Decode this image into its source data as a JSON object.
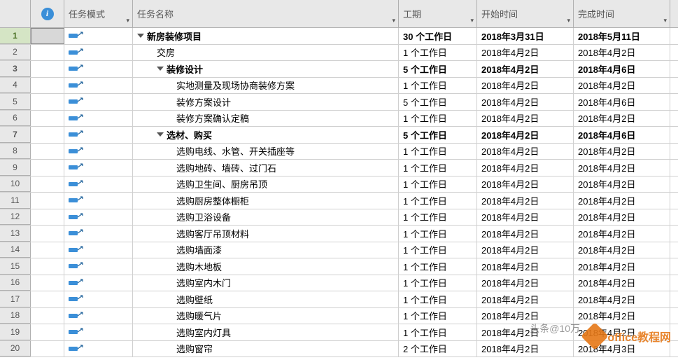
{
  "columns": {
    "task_mode": "任务模式",
    "task_name": "任务名称",
    "duration": "工期",
    "start": "开始时间",
    "finish": "完成时间"
  },
  "selected_row": 1,
  "rows": [
    {
      "num": 1,
      "indent": 0,
      "bold": true,
      "expand": true,
      "name": "新房装修项目",
      "duration": "30 个工作日",
      "start": "2018年3月31日",
      "finish": "2018年5月11日"
    },
    {
      "num": 2,
      "indent": 1,
      "bold": false,
      "expand": false,
      "name": "交房",
      "duration": "1 个工作日",
      "start": "2018年4月2日",
      "finish": "2018年4月2日"
    },
    {
      "num": 3,
      "indent": 1,
      "bold": true,
      "expand": true,
      "name": "装修设计",
      "duration": "5 个工作日",
      "start": "2018年4月2日",
      "finish": "2018年4月6日"
    },
    {
      "num": 4,
      "indent": 2,
      "bold": false,
      "expand": false,
      "name": "实地测量及现场协商装修方案",
      "duration": "1 个工作日",
      "start": "2018年4月2日",
      "finish": "2018年4月2日"
    },
    {
      "num": 5,
      "indent": 2,
      "bold": false,
      "expand": false,
      "name": "装修方案设计",
      "duration": "5 个工作日",
      "start": "2018年4月2日",
      "finish": "2018年4月6日"
    },
    {
      "num": 6,
      "indent": 2,
      "bold": false,
      "expand": false,
      "name": "装修方案确认定稿",
      "duration": "1 个工作日",
      "start": "2018年4月2日",
      "finish": "2018年4月2日"
    },
    {
      "num": 7,
      "indent": 1,
      "bold": true,
      "expand": true,
      "name": "选材、购买",
      "duration": "5 个工作日",
      "start": "2018年4月2日",
      "finish": "2018年4月6日"
    },
    {
      "num": 8,
      "indent": 2,
      "bold": false,
      "expand": false,
      "name": "选购电线、水管、开关插座等",
      "duration": "1 个工作日",
      "start": "2018年4月2日",
      "finish": "2018年4月2日"
    },
    {
      "num": 9,
      "indent": 2,
      "bold": false,
      "expand": false,
      "name": "选购地砖、墙砖、过门石",
      "duration": "1 个工作日",
      "start": "2018年4月2日",
      "finish": "2018年4月2日"
    },
    {
      "num": 10,
      "indent": 2,
      "bold": false,
      "expand": false,
      "name": "选购卫生间、厨房吊顶",
      "duration": "1 个工作日",
      "start": "2018年4月2日",
      "finish": "2018年4月2日"
    },
    {
      "num": 11,
      "indent": 2,
      "bold": false,
      "expand": false,
      "name": "选购厨房整体橱柜",
      "duration": "1 个工作日",
      "start": "2018年4月2日",
      "finish": "2018年4月2日"
    },
    {
      "num": 12,
      "indent": 2,
      "bold": false,
      "expand": false,
      "name": "选购卫浴设备",
      "duration": "1 个工作日",
      "start": "2018年4月2日",
      "finish": "2018年4月2日"
    },
    {
      "num": 13,
      "indent": 2,
      "bold": false,
      "expand": false,
      "name": "选购客厅吊顶材料",
      "duration": "1 个工作日",
      "start": "2018年4月2日",
      "finish": "2018年4月2日"
    },
    {
      "num": 14,
      "indent": 2,
      "bold": false,
      "expand": false,
      "name": "选购墙面漆",
      "duration": "1 个工作日",
      "start": "2018年4月2日",
      "finish": "2018年4月2日"
    },
    {
      "num": 15,
      "indent": 2,
      "bold": false,
      "expand": false,
      "name": "选购木地板",
      "duration": "1 个工作日",
      "start": "2018年4月2日",
      "finish": "2018年4月2日"
    },
    {
      "num": 16,
      "indent": 2,
      "bold": false,
      "expand": false,
      "name": "选购室内木门",
      "duration": "1 个工作日",
      "start": "2018年4月2日",
      "finish": "2018年4月2日"
    },
    {
      "num": 17,
      "indent": 2,
      "bold": false,
      "expand": false,
      "name": "选购壁纸",
      "duration": "1 个工作日",
      "start": "2018年4月2日",
      "finish": "2018年4月2日"
    },
    {
      "num": 18,
      "indent": 2,
      "bold": false,
      "expand": false,
      "name": "选购暖气片",
      "duration": "1 个工作日",
      "start": "2018年4月2日",
      "finish": "2018年4月2日"
    },
    {
      "num": 19,
      "indent": 2,
      "bold": false,
      "expand": false,
      "name": "选购室内灯具",
      "duration": "1 个工作日",
      "start": "2018年4月2日",
      "finish": "2018年4月2日"
    },
    {
      "num": 20,
      "indent": 2,
      "bold": false,
      "expand": false,
      "name": "选购窗帘",
      "duration": "2 个工作日",
      "start": "2018年4月2日",
      "finish": "2018年4月3日"
    }
  ],
  "watermark": {
    "text1": "头条@10万",
    "text2": "office教程网"
  }
}
